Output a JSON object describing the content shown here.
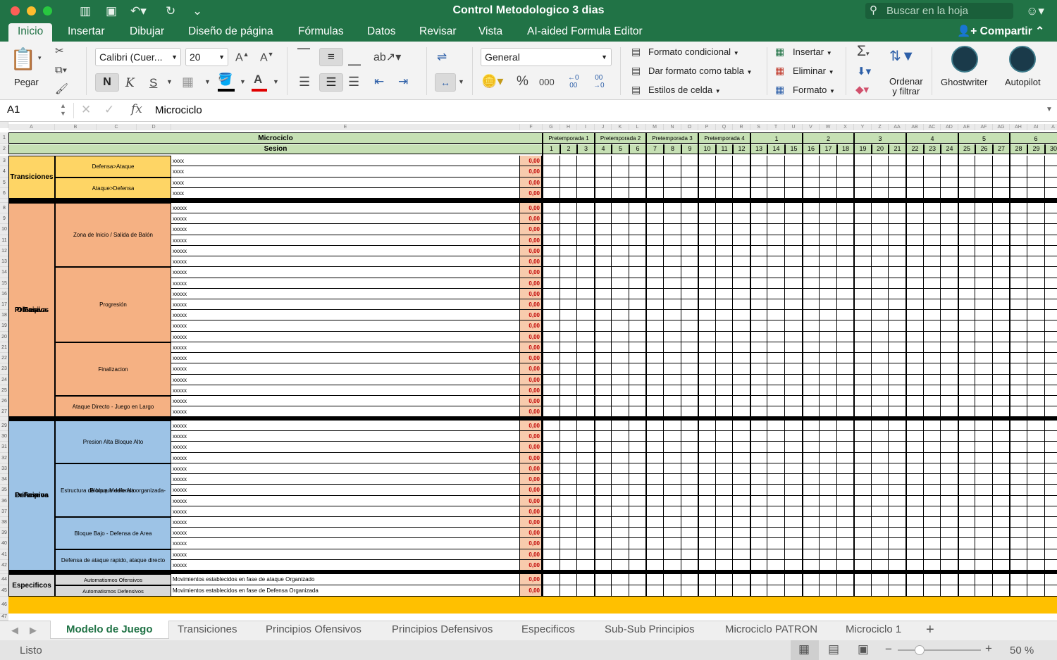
{
  "window": {
    "title": "Control Metodologico 3 dias",
    "search_placeholder": "Buscar en la hoja"
  },
  "menu": {
    "tabs": [
      "Inicio",
      "Insertar",
      "Dibujar",
      "Diseño de página",
      "Fórmulas",
      "Datos",
      "Revisar",
      "Vista",
      "AI-aided Formula Editor"
    ],
    "share": "Compartir"
  },
  "ribbon": {
    "paste": "Pegar",
    "font_name": "Calibri (Cuer...",
    "font_size": "20",
    "bold": "N",
    "italic": "K",
    "underline": "S",
    "number_format": "General",
    "percent": "%",
    "thousands": "000",
    "cond_format": "Formato condicional",
    "format_table": "Dar formato como tabla",
    "cell_styles": "Estilos de celda",
    "insert": "Insertar",
    "delete": "Eliminar",
    "format": "Formato",
    "sort_filter_1": "Ordenar",
    "sort_filter_2": "y filtrar",
    "ghostwriter": "Ghostwriter",
    "autopilot": "Autopilot"
  },
  "formula_bar": {
    "cell_ref": "A1",
    "fx": "fx",
    "value": "Microciclo"
  },
  "sheet": {
    "columns": [
      "A",
      "B",
      "C",
      "D",
      "E",
      "F",
      "G",
      "H",
      "I",
      "J",
      "K",
      "L",
      "M",
      "N",
      "O",
      "P",
      "Q",
      "R",
      "S",
      "T",
      "U",
      "V",
      "W",
      "X",
      "Y",
      "Z",
      "AA",
      "AB",
      "AC",
      "AD",
      "AE",
      "AF",
      "AG",
      "AH",
      "AI",
      "A"
    ],
    "row_numbers": [
      "1",
      "2",
      "3",
      "4",
      "5",
      "6",
      "8",
      "9",
      "10",
      "11",
      "12",
      "13",
      "14",
      "15",
      "16",
      "17",
      "18",
      "19",
      "20",
      "21",
      "22",
      "23",
      "24",
      "25",
      "26",
      "27",
      "29",
      "30",
      "31",
      "32",
      "33",
      "34",
      "35",
      "36",
      "37",
      "38",
      "39",
      "40",
      "41",
      "42",
      "44",
      "45",
      "46",
      "47"
    ],
    "microciclo": "Microciclo",
    "sesion": "Sesion",
    "pretemporadas": [
      "Pretemporada 1",
      "Pretemporada 2",
      "Pretemporada 3",
      "Pretemporada 4"
    ],
    "weeks": [
      "1",
      "2",
      "3",
      "4",
      "5",
      "6"
    ],
    "sessions": [
      "1",
      "2",
      "3",
      "4",
      "5",
      "6",
      "7",
      "8",
      "9",
      "10",
      "11",
      "12",
      "13",
      "14",
      "15",
      "16",
      "17",
      "18",
      "19",
      "20",
      "21",
      "22",
      "23",
      "24",
      "25",
      "26",
      "27",
      "28",
      "29",
      "30"
    ],
    "zero": "0,00",
    "xxxx": "xxxx",
    "xxxxx": "xxxxx",
    "groups": {
      "transiciones": "Transiciones",
      "ofensiva": [
        "Principios",
        "Fase",
        "Ofensiva"
      ],
      "defensiva": [
        "Principios",
        "Fase",
        "Defensiva"
      ],
      "especificos": "Especificos"
    },
    "subgroups": {
      "def_ataque": "Defensa>Ataque",
      "ataque_def": "Ataque>Defensa",
      "zona_inicio": "Zona de Inicio / Salida de Balón",
      "progresion": "Progresión",
      "finalizacion": "Finalizacion",
      "ataque_directo": "Ataque Directo - Juego en Largo",
      "presion_alta": "Presion Alta  Bloque Alto",
      "estructura_1": "Estructura de bloque defensa organizada-",
      "estructura_2": "Bloque Medio-Alto",
      "bloque_bajo": "Bloque Bajo - Defensa de Area",
      "defensa_rapido": "Defensa de ataque rapido, ataque directo",
      "auto_ofensivos": "Automatismos Ofensivos",
      "auto_defensivos": "Automatismos Defensivos"
    },
    "especificos_rows": [
      "Movimientos establecidos en fase de ataque Organizado",
      "Movimientos establecidos en fase de Defensa Organizada"
    ]
  },
  "sheet_tabs": [
    "Modelo de Juego",
    "Transiciones",
    "Principios Ofensivos",
    "Principios Defensivos",
    "Especificos",
    "Sub-Sub Principios",
    "Microciclo PATRON",
    "Microciclo 1"
  ],
  "status": {
    "ready": "Listo",
    "zoom": "50 %"
  },
  "colors": {
    "excel_green": "#217346",
    "yellow": "#fed565",
    "orange": "#f5b183",
    "blue": "#9dc3e6",
    "green_header": "#c6e0b4",
    "pink": "#f8cbad",
    "gold": "#ffc000",
    "gray_group": "#d9d9d9"
  }
}
